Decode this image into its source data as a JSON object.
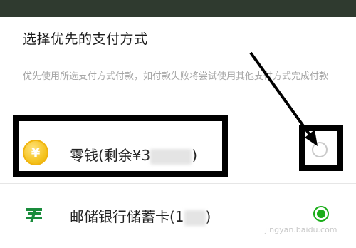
{
  "sheet": {
    "title": "选择优先的支付方式",
    "subtitle": "优先使用所选支付方式付款，如付款失败将尝试使用其他支付方式完成付款"
  },
  "options": [
    {
      "label_before_mask": "零钱(剩余¥3",
      "label_after_mask": ")",
      "icon": "coin-icon",
      "icon_glyph": "¥",
      "selected": false
    },
    {
      "label_before_mask": "邮储银行储蓄卡(1",
      "label_after_mask": ")",
      "icon": "postal-bank-icon",
      "selected": true
    }
  ],
  "watermark": "jingyan.baidu.com",
  "colors": {
    "accent": "#1aad19",
    "annotation": "#000000",
    "coin": "#f4c21d",
    "postal_green": "#1a8c3c"
  }
}
